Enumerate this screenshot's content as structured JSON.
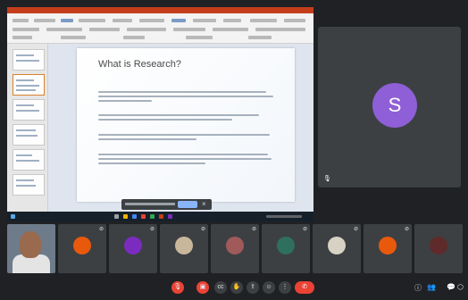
{
  "presentation": {
    "slide_title": "What is Research?"
  },
  "speaker": {
    "avatar_initial": "S",
    "avatar_color": "#8e5fd6"
  },
  "participants": [
    {
      "initial": "",
      "type": "video"
    },
    {
      "initial": "",
      "color": "#e8590c"
    },
    {
      "initial": "",
      "color": "#7b2cbf"
    },
    {
      "initial": "",
      "type": "photo"
    },
    {
      "initial": "",
      "type": "photo"
    },
    {
      "initial": "",
      "color": "#2f6f5e"
    },
    {
      "initial": "",
      "type": "photo"
    },
    {
      "initial": "",
      "color": "#e8590c"
    },
    {
      "initial": "",
      "type": "more"
    }
  ],
  "colors": {
    "end_call": "#ea4335",
    "stop_share": "#8ab4f8",
    "ppt_accent": "#c43e1c"
  }
}
